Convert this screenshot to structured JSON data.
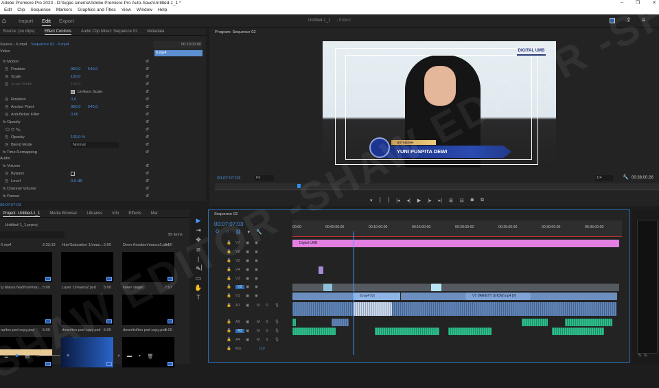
{
  "window": {
    "title": "Adobe Premiere Pro 2023 - D:\\tugas sinema\\Adobe Premiere Pro Auto-Save\\Untitled-1_1 *",
    "controls": [
      "–",
      "❐",
      "✕"
    ]
  },
  "menu": [
    "Edit",
    "Clip",
    "Sequence",
    "Markers",
    "Graphics and Titles",
    "View",
    "Window",
    "Help"
  ],
  "appbar": {
    "home": "⌂",
    "workspaces": [
      "Import",
      "Edit",
      "Export"
    ],
    "active": "Edit",
    "project_title": "Untitled-1_1",
    "status": "- Edited"
  },
  "effect_controls": {
    "tabs": [
      "Source: (no clips)",
      "Effect Controls",
      "Audio Clip Mixer: Sequence 02",
      "Metadata"
    ],
    "source": "Source - 6.mp4",
    "sequence": "Sequence 02 - 6.mp4",
    "mini_timecode": "00:10:00:00",
    "mini_clip": "6.mp4",
    "video_header": "Video",
    "audio_header": "Audio",
    "timecode": "00:07:07:03",
    "rows": [
      {
        "label": "fx  Motion",
        "type": "group"
      },
      {
        "label": "Position",
        "v1": "960,0",
        "v2": "540,0"
      },
      {
        "label": "Scale",
        "v1": "100,0"
      },
      {
        "label": "Scale Width",
        "v1": "100,0",
        "dim": true
      },
      {
        "label": "",
        "checkbox": "Uniform Scale"
      },
      {
        "label": "Rotation",
        "v1": "0,0"
      },
      {
        "label": "Anchor Point",
        "v1": "960,0",
        "v2": "540,0"
      },
      {
        "label": "Anti-flicker Filter",
        "v1": "0,00"
      },
      {
        "label": "fx  Opacity",
        "type": "group"
      },
      {
        "label": "",
        "masks": true
      },
      {
        "label": "Opacity",
        "v1": "100,0 %"
      },
      {
        "label": "Blend Mode",
        "select": "Normal"
      },
      {
        "label": "fx  Time Remapping",
        "type": "group"
      }
    ],
    "audio_rows": [
      {
        "label": "fx  Volume",
        "type": "group"
      },
      {
        "label": "Bypass",
        "checkbox": ""
      },
      {
        "label": "Level",
        "v1": "0,0 dB"
      },
      {
        "label": "fx  Channel Volume",
        "type": "group"
      },
      {
        "label": "fx  Panner",
        "type": "group"
      }
    ]
  },
  "program": {
    "title": "Program: Sequence 02",
    "timecode": "00:07:07:03",
    "fit": "Fit",
    "resolution": "1/4",
    "duration": "00:38:00:26",
    "overlay": {
      "logo": "DIGITAL UMB",
      "role": "USTADZAH",
      "name": "YUNI PUSPITA DEWI"
    },
    "controls": [
      "▾",
      "{",
      "}",
      "|◂",
      "◂|",
      "▶",
      "|▸",
      "▸|",
      "⊞",
      "⊟",
      "◙",
      "⧉"
    ],
    "playhead_fraction": 0.186
  },
  "project": {
    "tabs": [
      "Project: Untitled-1_1",
      "Media Browser",
      "Libraries",
      "Info",
      "Effects",
      "Mar"
    ],
    "file": "Untitled-1_1.prproj",
    "count": "99 items",
    "items": [
      {
        "name": "6.mp4",
        "dur": "2:33:19"
      },
      {
        "name": "Hue/Saturation 1/maur...",
        "dur": "5:00"
      },
      {
        "name": "Deen Assalam/maura2.psd",
        "dur": "5:00"
      },
      {
        "name": "ly Maura Nadhira/mau...",
        "dur": "5:00"
      },
      {
        "name": "Layer 1/maura2.psd",
        "dur": "5:00"
      },
      {
        "name": "lower singer",
        "dur": "7:07"
      },
      {
        "name": "op/tes psd copy.psd",
        "dur": "5:00"
      },
      {
        "name": "down/tes psd copy.psd",
        "dur": "5:00"
      },
      {
        "name": "downlist/tes psd copy.psd",
        "dur": "5:00"
      }
    ]
  },
  "tools": [
    "▶",
    "⇥",
    "✥",
    "⧄",
    "|↔|",
    "✎",
    "▭",
    "✋",
    "T"
  ],
  "timeline": {
    "title": "Sequence 02",
    "timecode": "00:07:07:03",
    "playhead_min": 7.07,
    "range_min": 38,
    "ruler": [
      "00:00",
      "00:05:00:00",
      "00:10:00:00",
      "00:15:00:00",
      "00:20:00:00",
      "00:25:00:00",
      "00:30:00:00",
      "00:35:00:00"
    ],
    "tracks": [
      "V7",
      "V6",
      "V5",
      "V4",
      "V3",
      "V2",
      "V1",
      "A1",
      "A2",
      "A3",
      "A4",
      "Mix"
    ],
    "mix_value": "0,0",
    "clips": [
      {
        "track": "V7",
        "start": 0,
        "end": 37.8,
        "label": "Digital UMB",
        "color": "#e27fe0"
      },
      {
        "track": "V4",
        "start": 3,
        "end": 3.6,
        "color": "#a78ad6"
      },
      {
        "track": "V2",
        "start": 0,
        "end": 37.8,
        "color": "#555a60"
      },
      {
        "track": "V2",
        "start": 3.6,
        "end": 4.6,
        "color": "#8fc0d8"
      },
      {
        "track": "V2",
        "start": 16,
        "end": 17.2,
        "color": "#b9e6f5"
      },
      {
        "track": "V1",
        "start": 0,
        "end": 7,
        "color": "#6c8fbf"
      },
      {
        "track": "V1",
        "start": 7,
        "end": 12.5,
        "label": "6.mp4 [V]",
        "color": "#8fb5e6"
      },
      {
        "track": "V1",
        "start": 12.5,
        "end": 20,
        "color": "#6c8fbf"
      },
      {
        "track": "V1",
        "start": 20,
        "end": 27.5,
        "label": "VT VARIETY SHOW.mp4 [V]",
        "color": "#7fa3d6"
      },
      {
        "track": "V1",
        "start": 27.5,
        "end": 37.5,
        "color": "#6c8fbf"
      },
      {
        "track": "A1",
        "start": 0,
        "end": 7,
        "color": "#5f84b8"
      },
      {
        "track": "A1",
        "start": 7,
        "end": 11.5,
        "color": "#c8d8ee"
      },
      {
        "track": "A1",
        "start": 11.5,
        "end": 37.5,
        "color": "#5f84b8"
      },
      {
        "track": "A2",
        "start": 0,
        "end": 0.4,
        "color": "#2dbd8a"
      },
      {
        "track": "A2",
        "start": 4.5,
        "end": 6.5,
        "color": "#5f84b8"
      },
      {
        "track": "A2",
        "start": 26.5,
        "end": 29.5,
        "color": "#2dbd8a"
      },
      {
        "track": "A2",
        "start": 31.5,
        "end": 37,
        "color": "#2dbd8a"
      },
      {
        "track": "A3",
        "start": 0,
        "end": 5,
        "color": "#2dbd8a"
      },
      {
        "track": "A3",
        "start": 9.5,
        "end": 17,
        "color": "#2dbd8a"
      },
      {
        "track": "A3",
        "start": 18,
        "end": 23,
        "color": "#2dbd8a"
      },
      {
        "track": "A3",
        "start": 30,
        "end": 36,
        "color": "#2dbd8a"
      }
    ]
  },
  "colors": {
    "accent": "#2d8ceb",
    "panel": "#232323",
    "pink": "#e27fe0",
    "audio_green": "#2dbd8a"
  },
  "watermark": "SHAW EDITOR -"
}
